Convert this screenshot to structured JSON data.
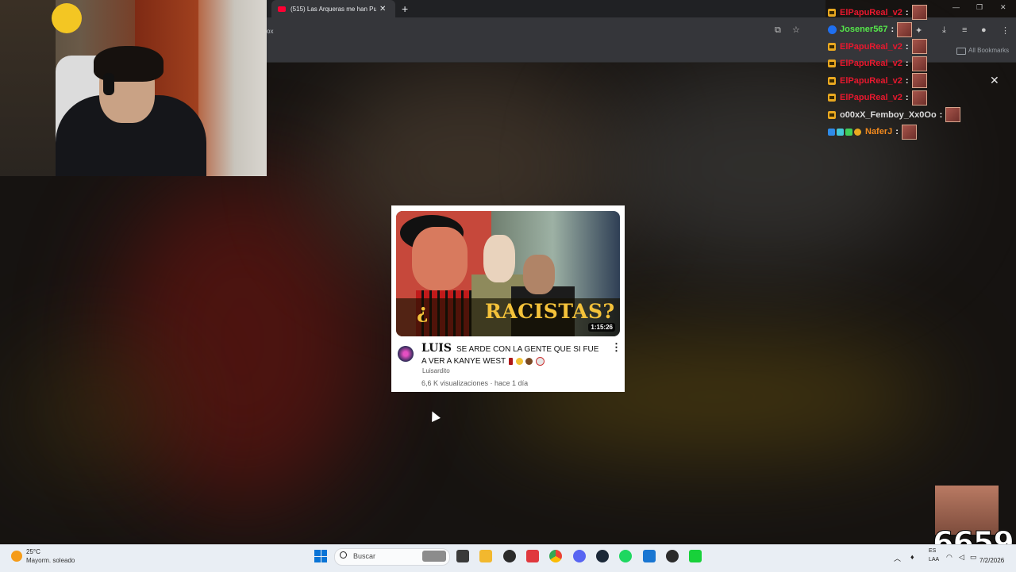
{
  "browser": {
    "tab_title": "(515) Las Arqueras me han Pue",
    "address_fragment": "ox",
    "all_bookmarks": "All Bookmarks"
  },
  "chat": {
    "messages": [
      {
        "user": "ElPapuReal_v2",
        "color": "#e8182e"
      },
      {
        "user": "Josener567",
        "color": "#55e64a"
      },
      {
        "user": "ElPapuReal_v2",
        "color": "#e8182e"
      },
      {
        "user": "ElPapuReal_v2",
        "color": "#e8182e"
      },
      {
        "user": "ElPapuReal_v2",
        "color": "#e8182e"
      },
      {
        "user": "ElPapuReal_v2",
        "color": "#e8182e"
      },
      {
        "user": "o00xX_Femboy_Xx0Oo",
        "color": "#dcdcdc"
      },
      {
        "user": "NaferJ",
        "color": "#f1891e"
      }
    ],
    "separator": ":"
  },
  "video": {
    "thumbnail_text": "RACISTAS?",
    "thumbnail_prefix": "¿",
    "duration": "1:15:26",
    "title_logo": "LUIS",
    "title": "SE ARDE CON LA GENTE QUE SI FUE A VER A KANYE WEST",
    "channel": "Luisardito",
    "meta": "6,6 K visualizaciones · hace 1 día"
  },
  "overlay": {
    "counter": "6659"
  },
  "taskbar": {
    "weather_temp": "25°C",
    "weather_desc": "Mayorm. soleado",
    "search_placeholder": "Buscar",
    "lang_a": "ES",
    "lang_b": "LAA",
    "date": "7/2/2026"
  },
  "colors": {
    "accent_red": "#ff0033",
    "windows_blue": "#0a74d6"
  }
}
